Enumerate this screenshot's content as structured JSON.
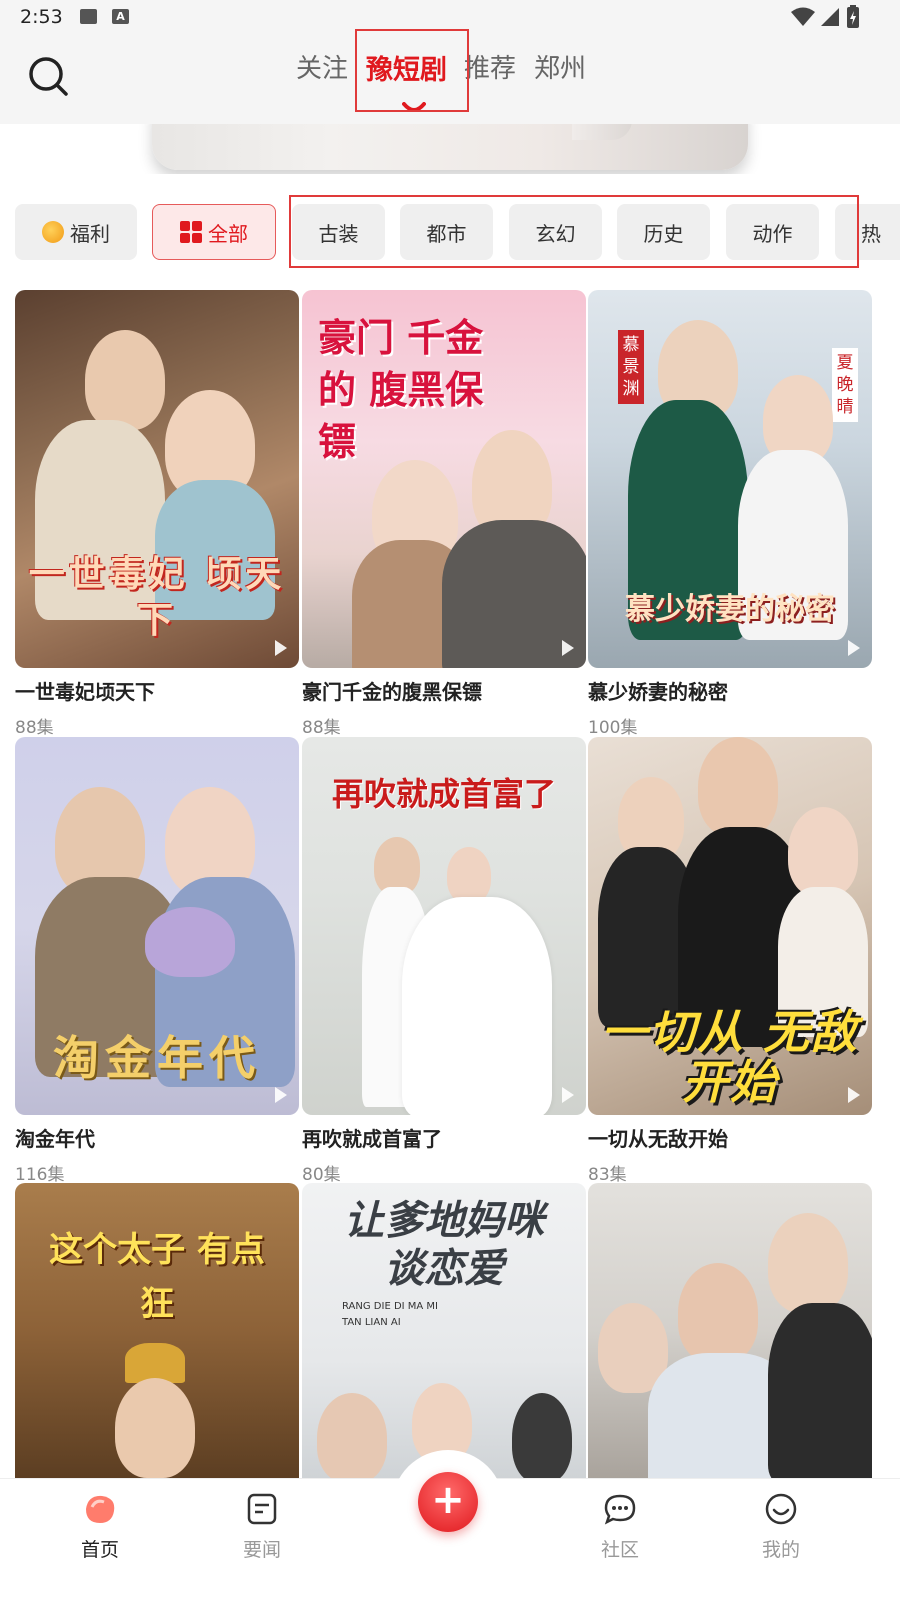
{
  "status_bar": {
    "time": "2:53",
    "icons": [
      "image-icon",
      "a-icon",
      "wifi-icon",
      "signal-icon",
      "battery-icon"
    ]
  },
  "header": {
    "search_icon": "search-icon",
    "tabs": [
      {
        "label": "关注",
        "active": false
      },
      {
        "label": "豫短剧",
        "active": true
      },
      {
        "label": "推荐",
        "active": false
      },
      {
        "label": "郑州",
        "active": false
      }
    ]
  },
  "chips": [
    {
      "label": "福利",
      "icon": "coin-icon",
      "active": false
    },
    {
      "label": "全部",
      "icon": "grid-icon",
      "active": true
    },
    {
      "label": "古装"
    },
    {
      "label": "都市"
    },
    {
      "label": "玄幻"
    },
    {
      "label": "历史"
    },
    {
      "label": "动作"
    },
    {
      "label": "热"
    }
  ],
  "dramas": [
    {
      "poster_title": "一世毒妃 顷天下",
      "name": "一世毒妃顷天下",
      "episodes": "88集"
    },
    {
      "poster_title": "豪门 千金的 腹黑保镖",
      "name": "豪门千金的腹黑保镖",
      "episodes": "88集"
    },
    {
      "poster_title": "慕少娇妻的秘密",
      "name": "慕少娇妻的秘密",
      "episodes": "100集",
      "side_names": [
        "慕景渊",
        "夏晚晴"
      ]
    },
    {
      "poster_title": "淘金年代",
      "name": "淘金年代",
      "episodes": "116集"
    },
    {
      "poster_title": "再吹就成首富了",
      "name": "再吹就成首富了",
      "episodes": "80集"
    },
    {
      "poster_title": "一切从 无敌开始",
      "name": "一切从无敌开始",
      "episodes": "83集"
    },
    {
      "poster_title": "这个太子 有点狂"
    },
    {
      "poster_title": "让爹地妈咪谈恋爱",
      "poster_subtitle_1": "RANG DIE DI MA MI",
      "poster_subtitle_2": "TAN LIAN AI"
    },
    {
      "poster_title": ""
    }
  ],
  "bottom_nav": [
    {
      "label": "首页",
      "icon": "home-icon",
      "active": true
    },
    {
      "label": "要闻",
      "icon": "news-icon",
      "active": false
    },
    {
      "label": "社区",
      "icon": "chat-icon",
      "active": false
    },
    {
      "label": "我的",
      "icon": "smile-icon",
      "active": false
    }
  ],
  "fab": {
    "label": "+",
    "icon": "plus-icon"
  },
  "colors": {
    "accent": "#e0191e",
    "chip_bg": "#efefef",
    "header_bg": "#f5f5f5"
  }
}
